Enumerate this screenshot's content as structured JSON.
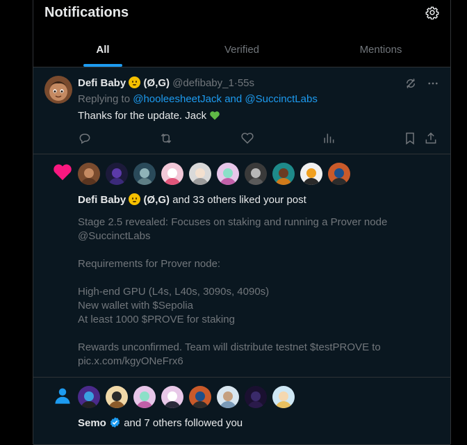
{
  "header": {
    "title": "Notifications",
    "settings_icon": "gear-icon"
  },
  "tabs": [
    {
      "label": "All",
      "active": true
    },
    {
      "label": "Verified",
      "active": false
    },
    {
      "label": "Mentions",
      "active": false
    }
  ],
  "reply_notification": {
    "name": "Defi Baby",
    "name_suffix": "(Ø,G)",
    "handle": "@defibaby_1",
    "time": "55s",
    "replying_prefix": "Replying to",
    "replying_to": "@hooleesheetJack and @SuccinctLabs",
    "text": "Thanks for the update. Jack",
    "icons": [
      "reply-icon",
      "repost-icon",
      "like-icon",
      "views-icon",
      "bookmark-icon",
      "share-icon",
      "grok-icon",
      "more-icon"
    ]
  },
  "like_notification": {
    "icon": "heart-icon",
    "name": "Defi Baby",
    "name_suffix": "(Ø,G)",
    "summary": " and 33 others liked your post",
    "post_lines": [
      "Stage 2.5 revealed: Focuses on staking and running a Prover node",
      "@SuccinctLabs",
      "",
      "Requirements for Prover node:",
      "",
      "High-end GPU (L4s, L40s, 3090s, 4090s)",
      "New wallet with $Sepolia",
      "At least 1000 $PROVE for staking",
      "",
      "Rewards unconfirmed. Team will distribute testnet $testPROVE to",
      "pic.x.com/kgyONeFrx6"
    ]
  },
  "follow_notification": {
    "icon": "person-icon",
    "name": "Semo",
    "summary": " and 7 others followed you"
  },
  "colors": {
    "accent": "#1d9bf0",
    "like": "#f91880",
    "text": "#e7e9ea",
    "muted": "#71767b",
    "border": "#2f3336"
  }
}
